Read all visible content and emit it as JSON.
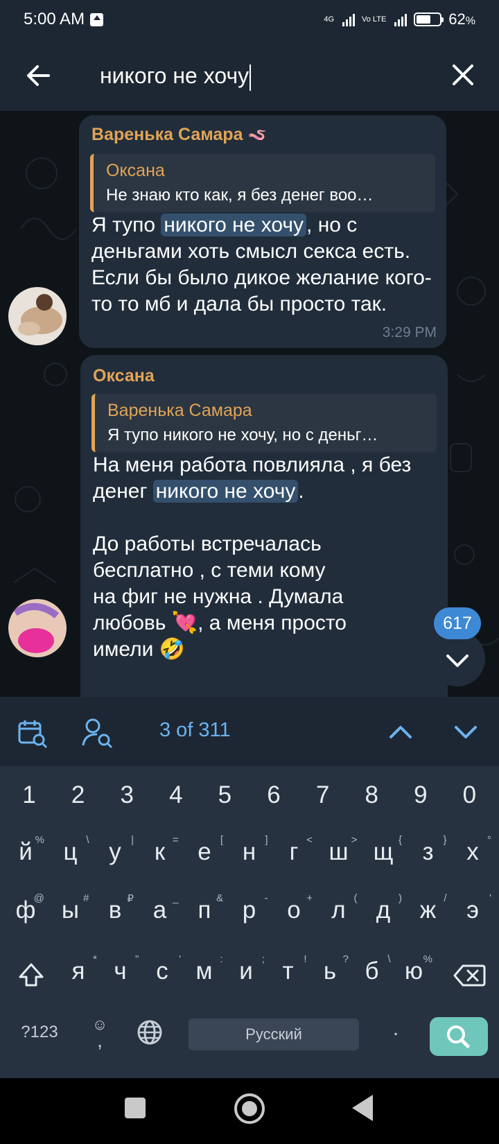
{
  "status_bar": {
    "time": "5:00 AM",
    "network_1": "4G",
    "network_2": "Vo LTE",
    "battery_percent": "62",
    "battery_symbol": "%",
    "battery_level": 0.62
  },
  "header": {
    "query": "никого не хочу",
    "back_icon": "back-arrow-icon",
    "clear_icon": "close-icon"
  },
  "messages": [
    {
      "sender": "Варенька Самара",
      "sender_emoji": "🪱",
      "reply_name": "Оксана",
      "reply_text": "Не знаю кто как, я без денег воо…",
      "text_before": "Я тупо ",
      "highlight": "никого не хочу",
      "text_after": ", но с деньгами хоть смысл секса есть. Если бы было дикое желание кого-то то мб и дала бы просто так.",
      "time": "3:29 PM"
    },
    {
      "sender": "Оксана",
      "reply_name": "Варенька Самара",
      "reply_text": "Я тупо никого не хочу, но с деньг…",
      "text_before": "На меня работа повлияла , я без денег ",
      "highlight": "никого не хочу",
      "text_after": ".",
      "paragraph2_line1": "До работы встречалась",
      "paragraph2_line2": "бесплатно , с теми кому",
      "paragraph2_line3": "на фиг не нужна . Думала",
      "paragraph2_line4_a": "любовь ",
      "paragraph2_line4_emoji": "💘",
      "paragraph2_line4_b": ",  а меня просто",
      "paragraph2_line5": "имели ",
      "paragraph2_line5_emoji": "🤣"
    }
  ],
  "unread_badge": "617",
  "search_nav": {
    "counter": "3 of 311",
    "calendar_icon": "calendar-search-icon",
    "user_icon": "user-search-icon",
    "up_icon": "chevron-up-icon",
    "down_icon": "chevron-down-icon"
  },
  "keyboard": {
    "numbers": [
      "1",
      "2",
      "3",
      "4",
      "5",
      "6",
      "7",
      "8",
      "9",
      "0"
    ],
    "row1": [
      {
        "k": "й",
        "s": "%"
      },
      {
        "k": "ц",
        "s": "\\"
      },
      {
        "k": "у",
        "s": "|"
      },
      {
        "k": "к",
        "s": "="
      },
      {
        "k": "е",
        "s": "["
      },
      {
        "k": "н",
        "s": "]"
      },
      {
        "k": "г",
        "s": "<"
      },
      {
        "k": "ш",
        "s": ">"
      },
      {
        "k": "щ",
        "s": "{"
      },
      {
        "k": "з",
        "s": "}"
      },
      {
        "k": "х",
        "s": "°"
      }
    ],
    "row2": [
      {
        "k": "ф",
        "s": "@"
      },
      {
        "k": "ы",
        "s": "#"
      },
      {
        "k": "в",
        "s": "₽"
      },
      {
        "k": "а",
        "s": "_"
      },
      {
        "k": "п",
        "s": "&"
      },
      {
        "k": "р",
        "s": "-"
      },
      {
        "k": "о",
        "s": "+"
      },
      {
        "k": "л",
        "s": "("
      },
      {
        "k": "д",
        "s": ")"
      },
      {
        "k": "ж",
        "s": "/"
      },
      {
        "k": "э",
        "s": "'"
      }
    ],
    "row3": [
      {
        "k": "я",
        "s": "*"
      },
      {
        "k": "ч",
        "s": "\""
      },
      {
        "k": "с",
        "s": "'"
      },
      {
        "k": "м",
        "s": ":"
      },
      {
        "k": "и",
        "s": ";"
      },
      {
        "k": "т",
        "s": "!"
      },
      {
        "k": "ь",
        "s": "?"
      },
      {
        "k": "б",
        "s": "\\"
      },
      {
        "k": "ю",
        "s": "%"
      }
    ],
    "symbols_key": "?123",
    "emoji_key_top": "☺",
    "emoji_key_bottom": ",",
    "space_label": "Русский",
    "period_key": "."
  },
  "colors": {
    "accent_name": "#e2a455",
    "link": "#6cb3f0",
    "bubble": "#212d3b",
    "search_button": "#6fc7bb"
  }
}
